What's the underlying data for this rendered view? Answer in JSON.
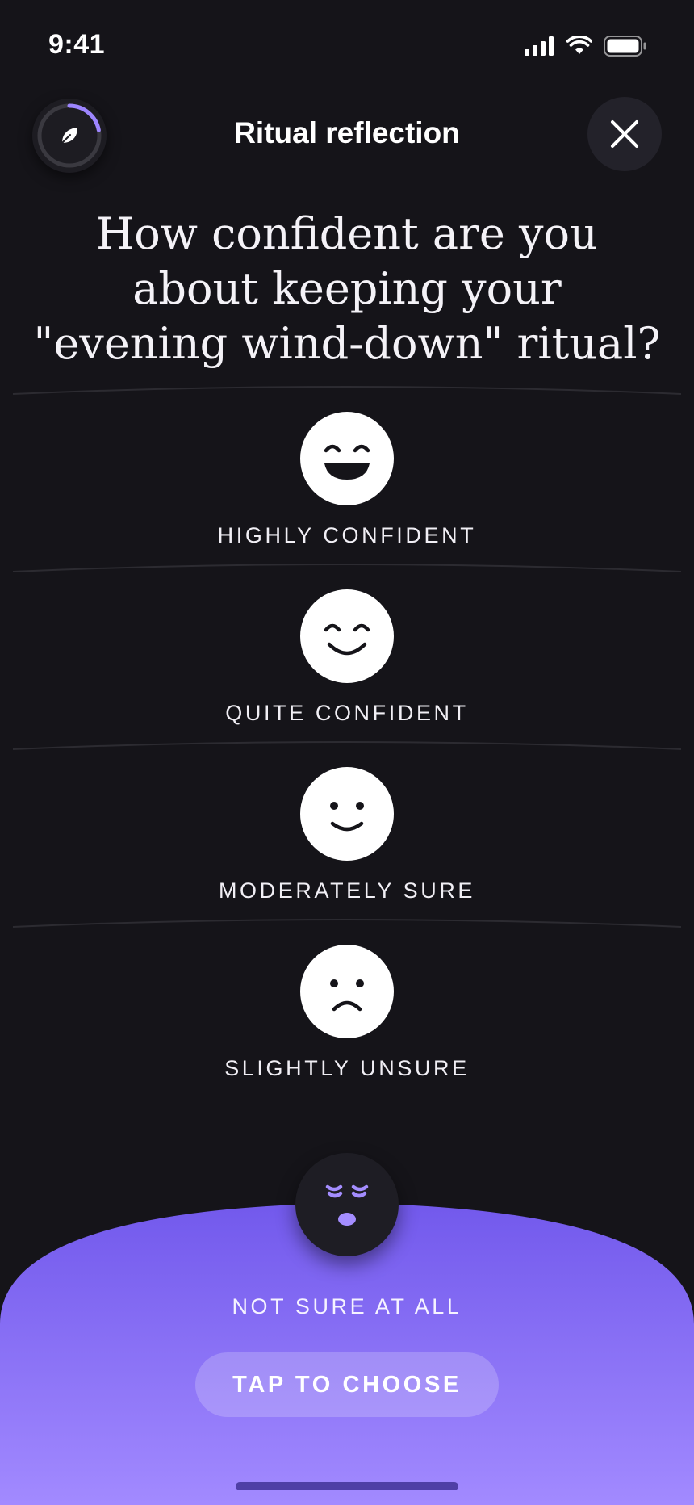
{
  "status_bar": {
    "time": "9:41"
  },
  "header": {
    "title": "Ritual reflection"
  },
  "question": "How confident are you about keeping your \"evening wind-down\" ritual?",
  "options": [
    {
      "label": "HIGHLY CONFIDENT",
      "face": "laughing-face-icon"
    },
    {
      "label": "QUITE CONFIDENT",
      "face": "smiling-face-icon"
    },
    {
      "label": "MODERATELY SURE",
      "face": "slight-smile-face-icon"
    },
    {
      "label": "SLIGHTLY UNSURE",
      "face": "frowning-face-icon"
    }
  ],
  "selected": {
    "label": "NOT SURE AT ALL",
    "face": "worried-face-icon"
  },
  "action": {
    "label": "TAP TO CHOOSE"
  },
  "progress": 0.22,
  "colors": {
    "background": "#151419",
    "accent": "#7b63f0",
    "accent_light": "#a48dff"
  }
}
